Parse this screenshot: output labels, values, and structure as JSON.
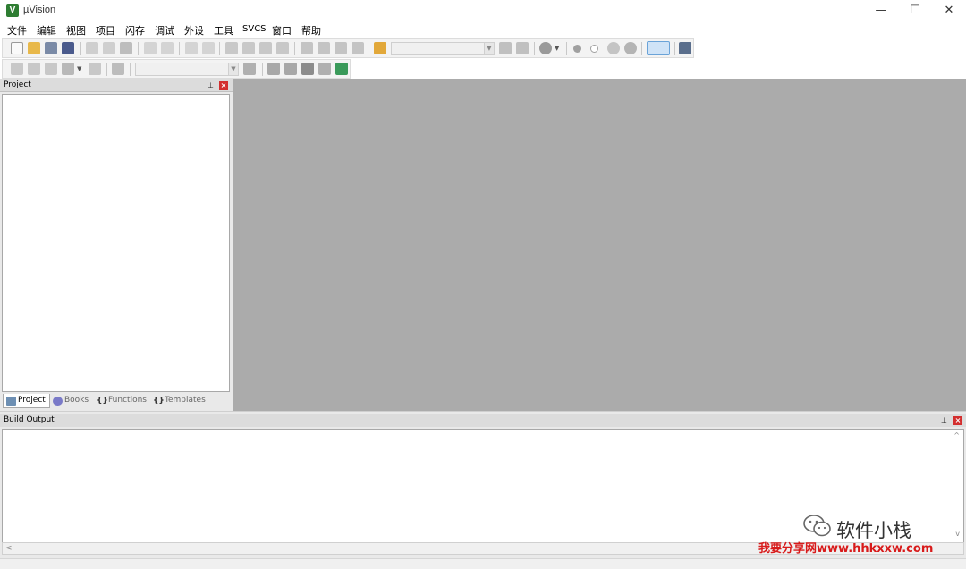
{
  "window": {
    "title": "µVision",
    "app_icon_glyph": "V",
    "controls": {
      "minimize": "—",
      "maximize": "☐",
      "close": "✕"
    }
  },
  "menu": {
    "items": [
      "文件",
      "编辑",
      "视图",
      "项目",
      "闪存",
      "调试",
      "外设",
      "工具",
      "SVCS",
      "窗口",
      "帮助"
    ]
  },
  "toolbar1": {
    "icons": [
      "new-file-icon",
      "open-folder-icon",
      "save-icon",
      "save-all-icon",
      "cut-icon",
      "copy-icon",
      "paste-icon",
      "undo-icon",
      "redo-icon",
      "nav-back-icon",
      "nav-forward-icon",
      "bookmark-icon",
      "bookmark-prev-icon",
      "bookmark-next-icon",
      "bookmark-clear-icon",
      "indent-icon",
      "unindent-icon",
      "comment-icon",
      "uncomment-icon",
      "find-in-files-icon",
      "find-combo",
      "find-icon",
      "incremental-find-icon",
      "debug-session-icon",
      "breakpoint-insert-icon",
      "breakpoint-enable-icon",
      "breakpoint-disable-icon",
      "breakpoint-kill-icon",
      "window-layout-icon",
      "configure-icon"
    ]
  },
  "toolbar2": {
    "icons": [
      "translate-icon",
      "build-icon",
      "rebuild-icon",
      "batch-build-icon",
      "stop-build-icon",
      "download-icon",
      "target-combo",
      "target-options-icon",
      "file-extensions-icon",
      "manage-components-icon",
      "select-pack-icon",
      "pack-installer-icon",
      "event-recorder-icon"
    ]
  },
  "project_panel": {
    "title": "Project",
    "pin_glyph": "⊥",
    "close_glyph": "×",
    "tabs": [
      "Project",
      "Books",
      "Functions",
      "Templates"
    ]
  },
  "build_output": {
    "title": "Build Output",
    "pin_glyph": "⊥",
    "close_glyph": "×",
    "scroll_left": "<",
    "scroll_up": "^",
    "scroll_down": "v"
  },
  "watermark": {
    "line1": "软件小栈",
    "line2": "我要分享网www.hhkxxw.com"
  },
  "colors": {
    "editor_background": "#ababab",
    "close_button_red": "#d32f2f",
    "watermark_red": "#d81b1b",
    "app_icon_green": "#2e7d32"
  }
}
